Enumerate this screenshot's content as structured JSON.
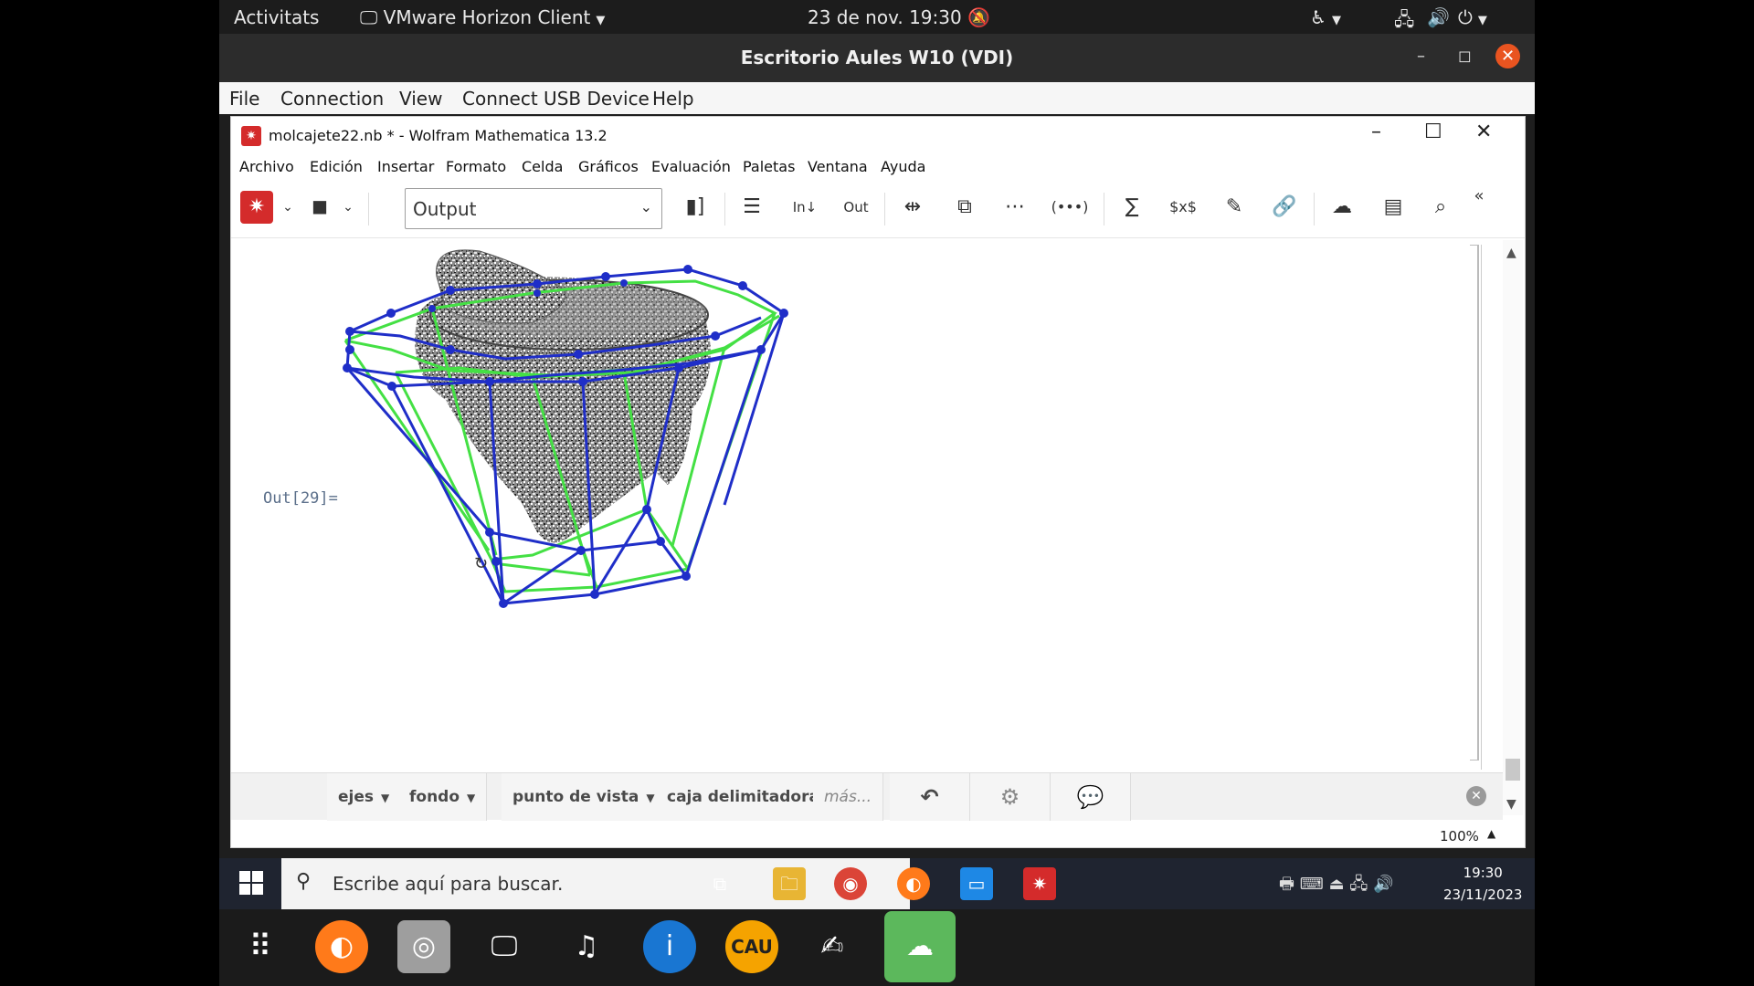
{
  "topbar": {
    "activities": "Activitats",
    "app_name": "VMware Horizon Client",
    "datetime": "23 de nov.  19:30"
  },
  "vmware": {
    "title": "Escritorio Aules W10 (VDI)",
    "menu": [
      "File",
      "Connection",
      "View",
      "Connect USB Device",
      "Help"
    ]
  },
  "mathematica": {
    "title": "molcajete22.nb * - Wolfram Mathematica 13.2",
    "menu": [
      "Archivo",
      "Edición",
      "Insertar",
      "Formato",
      "Celda",
      "Gráficos",
      "Evaluación",
      "Paletas",
      "Ventana",
      "Ayuda"
    ],
    "style_select": "Output",
    "out_label": "Out[29]=",
    "suggestions": {
      "axes": "ejes",
      "background": "fondo",
      "viewpoint": "punto de vista",
      "bounding_box": "caja delimitadora",
      "more": "más..."
    },
    "zoom": "100%"
  },
  "taskbar": {
    "search_placeholder": "Escribe aquí para buscar.",
    "time": "19:30",
    "date": "23/11/2023"
  },
  "colors": {
    "green_cage": "#44e044",
    "blue_cage": "#1f2ec8",
    "mma_red": "#d42b2b",
    "ubuntu_orange": "#e95420"
  }
}
